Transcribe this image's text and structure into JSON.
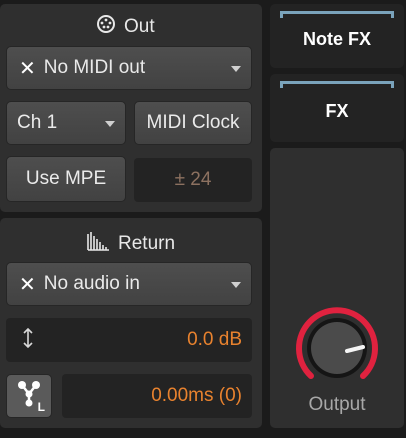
{
  "out": {
    "title": "Out",
    "midi_out": "No MIDI out",
    "channel": "Ch 1",
    "midi_clock": "MIDI Clock",
    "use_mpe": "Use MPE",
    "pitch_bend_range": "± 24"
  },
  "return": {
    "title": "Return",
    "audio_in": "No audio in",
    "gain": "0.0 dB",
    "latency": "0.00ms (0)",
    "latency_icon_badge": "L"
  },
  "side": {
    "note_fx": "Note FX",
    "fx": "FX",
    "output_label": "Output"
  },
  "colors": {
    "accent_orange": "#e8822e",
    "knob_ring_red": "#e0223f",
    "fx_slot_blue": "#7aa3bb"
  }
}
